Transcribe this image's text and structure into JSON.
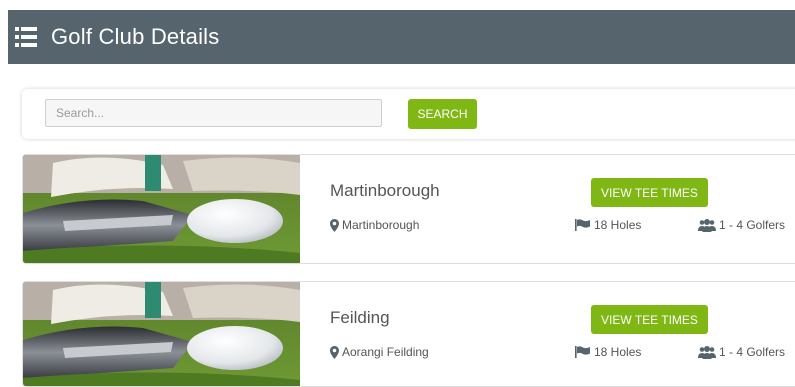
{
  "header": {
    "title": "Golf Club Details",
    "menu_icon": "hamburger-list-icon"
  },
  "search": {
    "placeholder": "Search...",
    "value": "",
    "button_label": "SEARCH"
  },
  "colors": {
    "header_bg": "#56646e",
    "accent_green": "#7fb814"
  },
  "clubs": [
    {
      "name": "Martinborough",
      "button_label": "VIEW TEE TIMES",
      "location": "Martinborough",
      "holes": "18 Holes",
      "golfers": "1 - 4 Golfers",
      "image": "golf-ball-putter-photo"
    },
    {
      "name": "Feilding",
      "button_label": "VIEW TEE TIMES",
      "location": "Aorangi Feilding",
      "holes": "18 Holes",
      "golfers": "1 - 4 Golfers",
      "image": "golf-ball-putter-photo"
    }
  ]
}
